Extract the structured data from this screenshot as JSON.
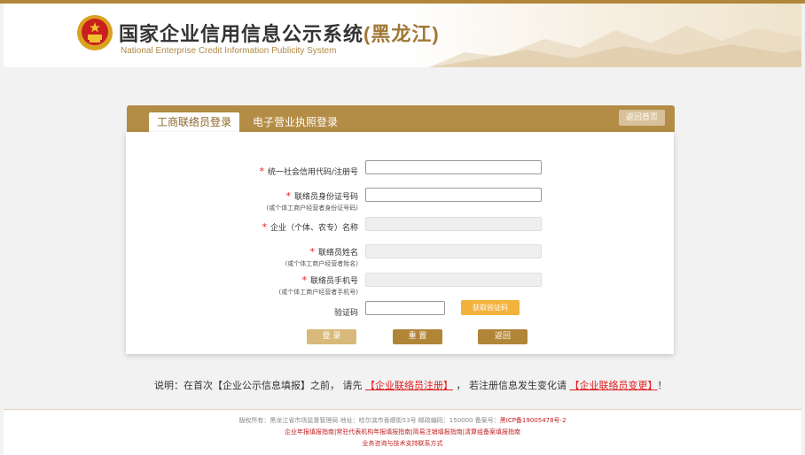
{
  "header": {
    "title_main": "国家企业信用信息公示系统",
    "title_province": "(黑龙江)",
    "subtitle": "National Enterprise Credit Information Publicity System"
  },
  "tabs": [
    {
      "label": "工商联络员登录",
      "active": true
    },
    {
      "label": "电子营业执照登录",
      "active": false
    }
  ],
  "home_button": "返回首页",
  "form": {
    "credit_code": {
      "label": "统一社会信用代码/注册号",
      "value": ""
    },
    "liaison_id": {
      "label": "联络员身份证号码",
      "note": "(或个体工商户经营者身份证号码)",
      "value": ""
    },
    "company_name": {
      "label": "企业（个体、农专）名称",
      "value": ""
    },
    "liaison_name": {
      "label": "联络员姓名",
      "note": "(或个体工商户经营者姓名)",
      "value": ""
    },
    "liaison_phone": {
      "label": "联络员手机号",
      "note": "(或个体工商户经营者手机号)",
      "value": ""
    },
    "captcha": {
      "label": "验证码",
      "value": ""
    },
    "get_code_button": "获取验证码",
    "required_mark": "*"
  },
  "buttons": {
    "login": "登 录",
    "reset": "重 置",
    "back": "返回"
  },
  "notice": {
    "prefix": "说明：在首次【企业公示信息填报】之前，  请先",
    "link1": "【企业联络员注册】",
    "middle": "，  若注册信息发生变化请",
    "link2": "【企业联络员变更】",
    "suffix": "！"
  },
  "footer": {
    "line1": "版权所有：黑龙江省市场监督管理局  地址：哈尔滨市香顺街53号  邮政编码：150000  备案号：",
    "icp": "黑ICP备19005478号-2",
    "line2": "企业年报填报指南|常驻代表机构年报填报指南|简易注销填报指南|清算组备案填报指南",
    "line3": "业务咨询与技术支持联系方式"
  },
  "colors": {
    "brand": "#b38c45",
    "accent": "#f3b23c",
    "link": "#e01f1f"
  }
}
